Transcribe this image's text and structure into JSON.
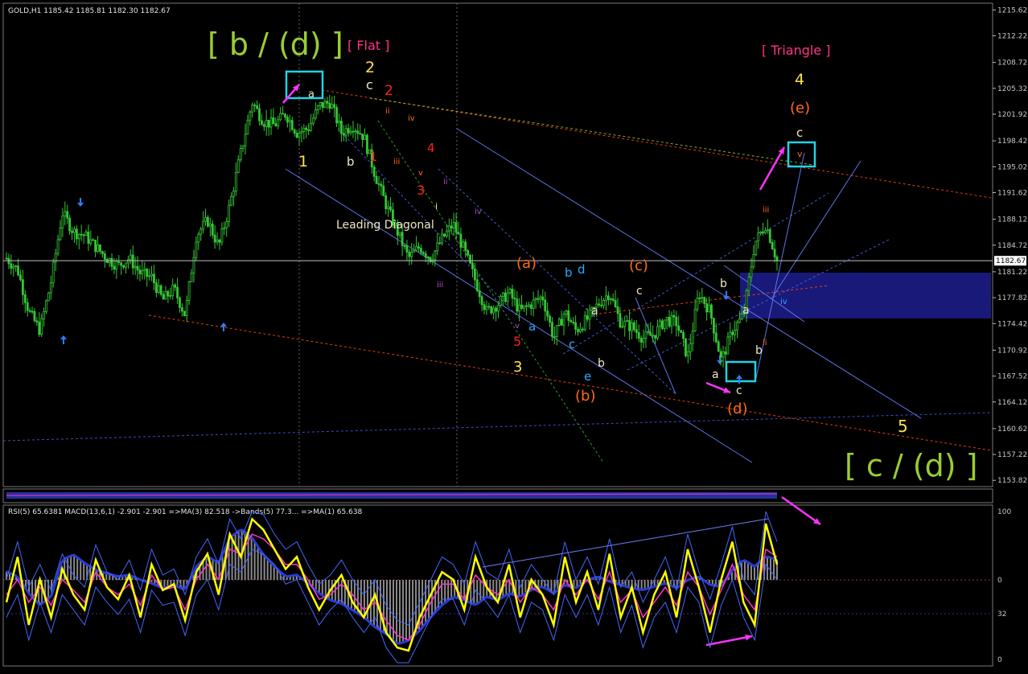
{
  "window": {
    "header": "GOLD,H1  1185.42 1185.81 1182.30 1182.67",
    "current_price": "1182.67",
    "indicator_header": "RSI(5) 65.6381 MACD(13,6,1) -2.901 -2.901  =>MA(3) 82.518  ->Bands(5) 77.3...  =>MA(1) 65.638"
  },
  "colors": {
    "background": "#000000",
    "candles": "#34c734",
    "rsi": "#ffff00",
    "ma": "#ff33cc",
    "bands": "#4466ff",
    "histogram": "#8a8a8a",
    "zone": "#1a1a80",
    "target_box": "#22d3e6",
    "arrow_magenta": "#ff33ff",
    "label_olive": "#9acd32",
    "label_yellow": "#ffe24a",
    "label_orange": "#ff6a1a",
    "label_red": "#ff2020",
    "label_white": "#f0e6c8",
    "label_cyan": "#2aa8ff",
    "label_purple": "#b84ad6",
    "label_pink": "#ff3388"
  },
  "chart_data": [
    {
      "type": "candlestick",
      "symbol": "GOLD",
      "timeframe": "H1",
      "y_axis_ticks": [
        "1215.62",
        "1212.22",
        "1208.72",
        "1205.32",
        "1201.92",
        "1198.42",
        "1195.02",
        "1191.62",
        "1188.12",
        "1184.72",
        "1181.22",
        "1177.82",
        "1174.42",
        "1170.92",
        "1167.52",
        "1164.12",
        "1160.62",
        "1157.22",
        "1153.82"
      ],
      "ylim": [
        1153.0,
        1216.5
      ],
      "current_price": 1182.67,
      "close_series_approx": [
        1183.0,
        1181.5,
        1176.0,
        1173.5,
        1180.0,
        1189.0,
        1186.5,
        1186.0,
        1184.5,
        1183.0,
        1182.0,
        1183.0,
        1181.0,
        1180.5,
        1177.5,
        1179.0,
        1175.5,
        1186.0,
        1188.0,
        1184.5,
        1190.0,
        1197.0,
        1203.5,
        1201.0,
        1200.5,
        1202.0,
        1199.5,
        1200.0,
        1203.0,
        1203.5,
        1199.5,
        1200.5,
        1199.0,
        1194.0,
        1190.0,
        1186.5,
        1183.0,
        1184.5,
        1183.0,
        1185.5,
        1187.5,
        1184.0,
        1180.0,
        1176.0,
        1177.0,
        1178.5,
        1176.0,
        1177.0,
        1178.0,
        1172.5,
        1176.0,
        1173.5,
        1175.0,
        1177.0,
        1178.5,
        1174.5,
        1174.0,
        1172.5,
        1173.0,
        1175.0,
        1174.5,
        1170.0,
        1178.5,
        1176.0,
        1169.5,
        1173.5,
        1175.5,
        1185.0,
        1187.5,
        1182.67
      ],
      "wave_labels": [
        {
          "text": "[ b / (d) ]",
          "color": "label_olive"
        },
        {
          "text": "[ Flat ]",
          "color": "label_pink"
        },
        {
          "text": "2",
          "color": "label_yellow"
        },
        {
          "text": "c",
          "color": "label_white"
        },
        {
          "text": "2",
          "color": "label_red"
        },
        {
          "text": "a",
          "color": "label_white"
        },
        {
          "text": "1",
          "color": "label_yellow"
        },
        {
          "text": "b",
          "color": "label_white"
        },
        {
          "text": "1",
          "color": "label_red"
        },
        {
          "text": "ii",
          "color": "label_orange"
        },
        {
          "text": "iv",
          "color": "label_orange"
        },
        {
          "text": "iii",
          "color": "label_orange"
        },
        {
          "text": "4",
          "color": "label_red"
        },
        {
          "text": "v",
          "color": "label_orange"
        },
        {
          "text": "3",
          "color": "label_red"
        },
        {
          "text": "ii",
          "color": "label_purple"
        },
        {
          "text": "i",
          "color": "label_white"
        },
        {
          "text": "Leading Diagonal",
          "color": "label_white"
        },
        {
          "text": "iv",
          "color": "label_purple"
        },
        {
          "text": "iii",
          "color": "label_purple"
        },
        {
          "text": "v",
          "color": "label_purple"
        },
        {
          "text": "5",
          "color": "label_red"
        },
        {
          "text": "3",
          "color": "label_yellow"
        },
        {
          "text": "(a)",
          "color": "label_orange"
        },
        {
          "text": "a",
          "color": "label_cyan"
        },
        {
          "text": "b",
          "color": "label_cyan"
        },
        {
          "text": "d",
          "color": "label_cyan"
        },
        {
          "text": "c",
          "color": "label_cyan"
        },
        {
          "text": "e",
          "color": "label_cyan"
        },
        {
          "text": "a",
          "color": "label_white"
        },
        {
          "text": "b",
          "color": "label_white"
        },
        {
          "text": "(b)",
          "color": "label_orange"
        },
        {
          "text": "(c)",
          "color": "label_orange"
        },
        {
          "text": "c",
          "color": "label_white"
        },
        {
          "text": "b",
          "color": "label_white"
        },
        {
          "text": "a",
          "color": "label_white"
        },
        {
          "text": "a",
          "color": "label_white"
        },
        {
          "text": "c",
          "color": "label_white"
        },
        {
          "text": "(d)",
          "color": "label_orange"
        },
        {
          "text": "b",
          "color": "label_white"
        },
        {
          "text": "ii",
          "color": "label_orange"
        },
        {
          "text": "iii",
          "color": "label_orange"
        },
        {
          "text": "iv",
          "color": "label_cyan"
        },
        {
          "text": "[ Triangle ]",
          "color": "label_pink"
        },
        {
          "text": "4",
          "color": "label_yellow"
        },
        {
          "text": "(e)",
          "color": "label_orange"
        },
        {
          "text": "c",
          "color": "label_white"
        },
        {
          "text": "v",
          "color": "label_orange"
        },
        {
          "text": "5",
          "color": "label_yellow"
        },
        {
          "text": "[ c / (d) ]",
          "color": "label_olive"
        }
      ]
    },
    {
      "type": "line",
      "title": "RSI(5) / MACD(13,6,1)",
      "y_axis_ticks": [
        "100",
        "0",
        "32",
        "0"
      ],
      "series": [
        {
          "name": "RSI(5)",
          "values": [
            40,
            70,
            25,
            55,
            30,
            62,
            45,
            35,
            68,
            50,
            42,
            58,
            30,
            65,
            48,
            52,
            28,
            60,
            72,
            45,
            85,
            70,
            95,
            88,
            75,
            62,
            70,
            50,
            35,
            48,
            58,
            40,
            30,
            45,
            20,
            10,
            8,
            30,
            45,
            60,
            55,
            35,
            70,
            50,
            40,
            65,
            30,
            55,
            45,
            25,
            70,
            40,
            60,
            35,
            72,
            30,
            50,
            20,
            45,
            60,
            30,
            75,
            50,
            20,
            55,
            80,
            40,
            25,
            92,
            65
          ]
        },
        {
          "name": "MA(3)",
          "values": [
            45,
            55,
            40,
            50,
            38,
            55,
            48,
            40,
            60,
            50,
            45,
            52,
            38,
            58,
            48,
            50,
            35,
            55,
            65,
            55,
            75,
            72,
            85,
            82,
            75,
            65,
            65,
            55,
            42,
            45,
            52,
            45,
            35,
            40,
            28,
            18,
            15,
            25,
            40,
            52,
            52,
            42,
            58,
            50,
            45,
            55,
            40,
            50,
            45,
            35,
            55,
            45,
            55,
            42,
            60,
            40,
            48,
            30,
            40,
            50,
            38,
            60,
            50,
            32,
            48,
            65,
            45,
            35,
            75,
            70
          ]
        },
        {
          "name": "MACD(13,6,1)",
          "values": [
            5,
            2,
            -8,
            -15,
            -10,
            12,
            15,
            10,
            6,
            4,
            2,
            3,
            0,
            -2,
            -5,
            -3,
            -6,
            8,
            14,
            10,
            25,
            30,
            25,
            15,
            8,
            2,
            3,
            -2,
            -8,
            -12,
            -14,
            -18,
            -22,
            -28,
            -32,
            -38,
            -36,
            -30,
            -22,
            -15,
            -10,
            -12,
            -15,
            -10,
            -12,
            -8,
            -10,
            -6,
            -4,
            -8,
            -3,
            -5,
            0,
            2,
            -1,
            -3,
            -5,
            -6,
            -4,
            -2,
            -5,
            0,
            2,
            -3,
            -4,
            6,
            12,
            8,
            14,
            12
          ]
        }
      ]
    }
  ]
}
